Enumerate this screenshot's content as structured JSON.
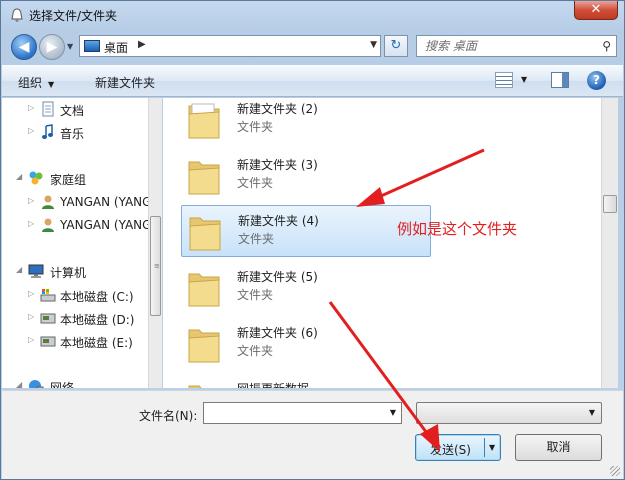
{
  "window": {
    "title": "选择文件/文件夹",
    "close_glyph": "✕"
  },
  "navigation": {
    "back_glyph": "◀",
    "forward_glyph": "▶",
    "address": "桌面",
    "address_chevron": "▶",
    "search_placeholder": "搜索 桌面"
  },
  "toolbar": {
    "organize": "组织",
    "new_folder": "新建文件夹",
    "help": "?"
  },
  "nav_pane": {
    "items": [
      {
        "label": "文档",
        "icon": "document-icon",
        "level": "child"
      },
      {
        "label": "音乐",
        "icon": "music-icon",
        "level": "child"
      },
      {
        "label": "家庭组",
        "icon": "homegroup-icon",
        "level": "root"
      },
      {
        "label": "YANGAN (YANGAN",
        "icon": "user-icon",
        "level": "child"
      },
      {
        "label": "YANGAN (YANGAN",
        "icon": "user-icon",
        "level": "child"
      },
      {
        "label": "计算机",
        "icon": "computer-icon",
        "level": "root"
      },
      {
        "label": "本地磁盘 (C:)",
        "icon": "drive-c-icon",
        "level": "child"
      },
      {
        "label": "本地磁盘 (D:)",
        "icon": "drive-icon",
        "level": "child"
      },
      {
        "label": "本地磁盘 (E:)",
        "icon": "drive-icon",
        "level": "child"
      },
      {
        "label": "网络",
        "icon": "network-icon",
        "level": "root"
      }
    ]
  },
  "files": [
    {
      "name": "新建文件夹 (2)",
      "type": "文件夹",
      "selected": false
    },
    {
      "name": "新建文件夹 (3)",
      "type": "文件夹",
      "selected": false
    },
    {
      "name": "新建文件夹 (4)",
      "type": "文件夹",
      "selected": true
    },
    {
      "name": "新建文件夹 (5)",
      "type": "文件夹",
      "selected": false
    },
    {
      "name": "新建文件夹 (6)",
      "type": "文件夹",
      "selected": false
    },
    {
      "name": "网振更新数据",
      "type": "",
      "selected": false
    }
  ],
  "annotation": "例如是这个文件夹",
  "bottom": {
    "filename_label": "文件名(N):",
    "filename_value": "",
    "file_type": "",
    "open_button": "发送(S)",
    "cancel_button": "取消"
  },
  "colors": {
    "annotation_red": "#e31e1e",
    "selection_blue": "#c8e2f9"
  }
}
